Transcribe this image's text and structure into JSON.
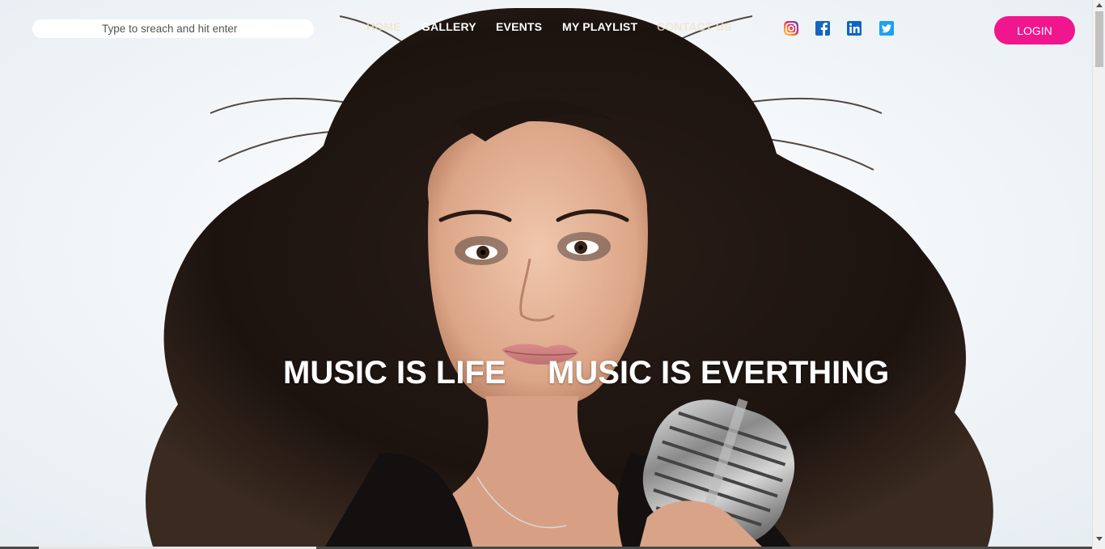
{
  "search": {
    "placeholder": "Type to sreach and hit enter"
  },
  "nav": {
    "items": [
      {
        "label": "HOME",
        "active": false
      },
      {
        "label": "GALLERY",
        "active": true
      },
      {
        "label": "EVENTS",
        "active": true
      },
      {
        "label": "MY PLAYLIST",
        "active": true
      },
      {
        "label": "CONTACT US",
        "active": false
      }
    ]
  },
  "social": [
    {
      "icon": "instagram-icon",
      "color": "#c13584"
    },
    {
      "icon": "facebook-icon",
      "color": "#1877f2"
    },
    {
      "icon": "linkedin-icon",
      "color": "#0a66c2"
    },
    {
      "icon": "twitter-icon",
      "color": "#1da1f2"
    }
  ],
  "header": {
    "login_label": "LOGIN",
    "login_color": "#f0168d"
  },
  "hero": {
    "tagline_left": "MUSIC IS LIFE",
    "tagline_right": "MUSIC IS EVERTHING"
  }
}
